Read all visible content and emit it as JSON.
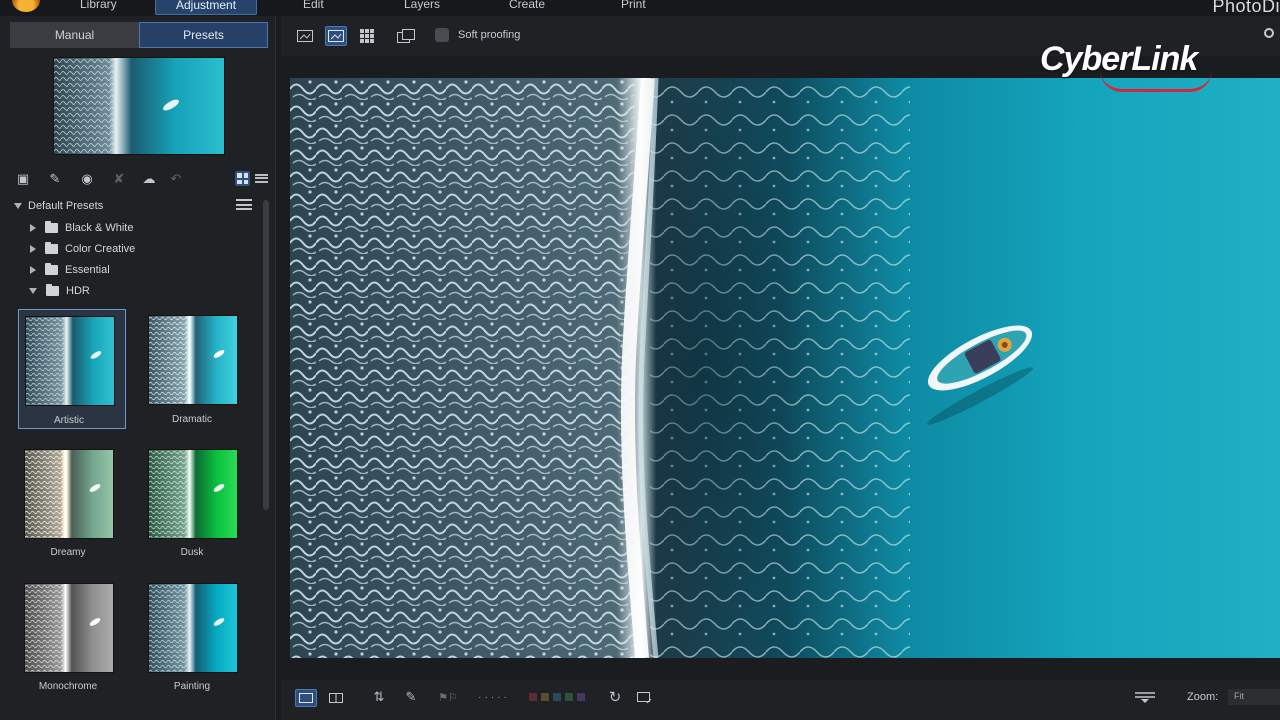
{
  "app": {
    "title": "PhotoDi"
  },
  "menu": {
    "items": [
      "Library",
      "Adjustment",
      "Edit",
      "Layers",
      "Create",
      "Print"
    ],
    "active": "Adjustment"
  },
  "left_panel": {
    "tabs": [
      "Manual",
      "Presets"
    ],
    "active_tab": "Presets",
    "tree": {
      "root": "Default Presets",
      "folders": [
        {
          "label": "Black & White",
          "expanded": false
        },
        {
          "label": "Color Creative",
          "expanded": false
        },
        {
          "label": "Essential",
          "expanded": false
        },
        {
          "label": "HDR",
          "expanded": true
        }
      ]
    },
    "presets": [
      {
        "label": "Artistic",
        "selected": true,
        "style": "artistic"
      },
      {
        "label": "Dramatic",
        "selected": false,
        "style": "dramatic"
      },
      {
        "label": "Dreamy",
        "selected": false,
        "style": "dreamy"
      },
      {
        "label": "Dusk",
        "selected": false,
        "style": "dusk"
      },
      {
        "label": "Monochrome",
        "selected": false,
        "style": "mono"
      },
      {
        "label": "Painting",
        "selected": false,
        "style": "painting"
      }
    ]
  },
  "toolbar": {
    "soft_proofing_label": "Soft proofing",
    "soft_proofing_checked": false
  },
  "branding": {
    "watermark": "CyberLink"
  },
  "status_bar": {
    "zoom_label": "Zoom:",
    "zoom_value": "Fit"
  },
  "colors": {
    "accent": "#2e4f7d",
    "accent_border": "#4a78ad",
    "panel_bg": "#202125",
    "ocean": "#1fa3b8"
  }
}
